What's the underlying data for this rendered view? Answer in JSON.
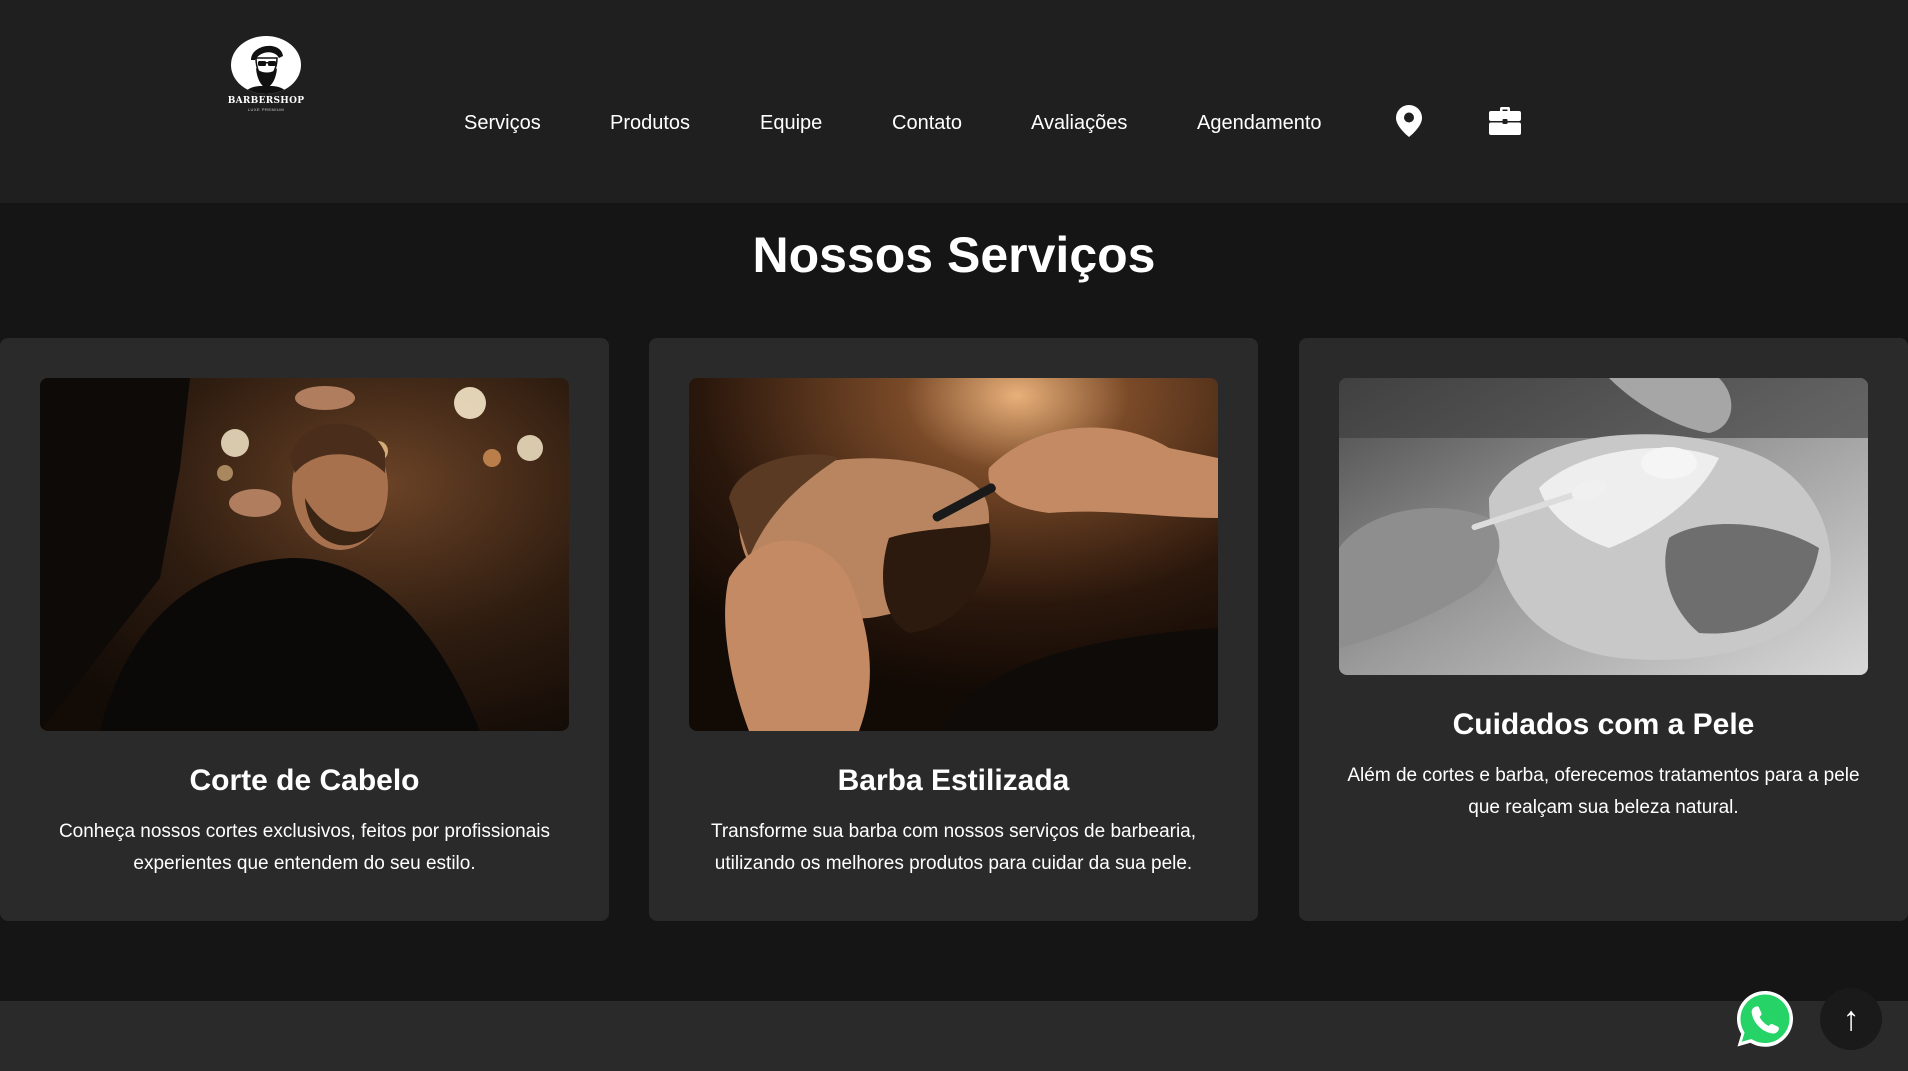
{
  "brand": {
    "name": "BARBERSHOP",
    "tagline": "LUXE PREMIUM"
  },
  "nav": {
    "items": [
      {
        "label": "Serviços"
      },
      {
        "label": "Produtos"
      },
      {
        "label": "Equipe"
      },
      {
        "label": "Contato"
      },
      {
        "label": "Avaliações"
      },
      {
        "label": "Agendamento"
      }
    ],
    "icons": [
      "map-pin-icon",
      "briefcase-icon"
    ]
  },
  "services": {
    "title": "Nossos Serviços",
    "cards": [
      {
        "title": "Corte de Cabelo",
        "text": "Conheça nossos cortes exclusivos, feitos por profissionais experientes que entendem do seu estilo.",
        "image_icon": "haircut-photo"
      },
      {
        "title": "Barba Estilizada",
        "text": "Transforme sua barba com nossos serviços de barbearia, utilizando os melhores produtos para cuidar da sua pele.",
        "image_icon": "beard-shave-photo"
      },
      {
        "title": "Cuidados com a Pele",
        "text": "Além de cortes e barba, oferecemos tratamentos para a pele que realçam sua beleza natural.",
        "image_icon": "skin-care-photo"
      }
    ]
  },
  "floating": {
    "whatsapp_icon": "whatsapp-icon",
    "scroll_top_glyph": "↑"
  },
  "colors": {
    "page_bg": "#151515",
    "header_bg": "#1f1f1f",
    "card_bg": "#2a2a2a",
    "text": "#ffffff",
    "whatsapp_green": "#25d366"
  }
}
